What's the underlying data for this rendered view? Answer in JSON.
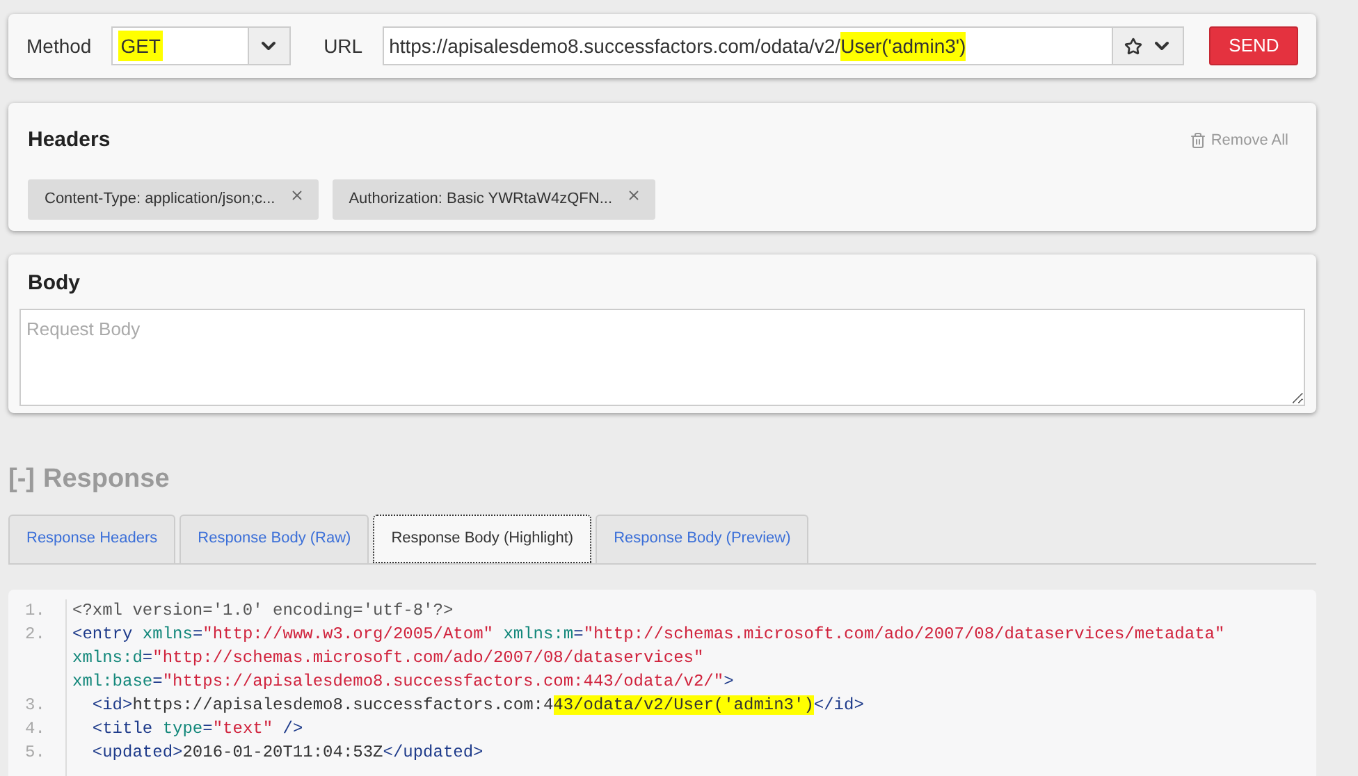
{
  "request": {
    "method_label": "Method",
    "method": {
      "value": "GET",
      "highlighted": true
    },
    "url_label": "URL",
    "url": [
      {
        "text": "https://apisalesdemo8.successfactors.com/odata/v2/",
        "highlighted": false
      },
      {
        "text": "User('admin3')",
        "highlighted": true
      }
    ],
    "send": "SEND"
  },
  "headers": {
    "title": "Headers",
    "remove_all": "Remove All",
    "items": [
      {
        "label": "Content-Type: application/json;c..."
      },
      {
        "label": "Authorization: Basic YWRtaW4zQFN..."
      }
    ]
  },
  "body": {
    "title": "Body",
    "placeholder": "Request Body"
  },
  "response": {
    "toggle": "[-]",
    "title": "Response",
    "tabs": [
      {
        "label": "Response Headers",
        "selected": false
      },
      {
        "label": "Response Body (Raw)",
        "selected": false
      },
      {
        "label": "Response Body (Highlight)",
        "selected": true
      },
      {
        "label": "Response Body (Preview)",
        "selected": false
      }
    ],
    "code": [
      {
        "number": "1.",
        "tokens": [
          {
            "kind": "decl",
            "text": "<?xml version='1.0' encoding='utf-8'?>"
          }
        ]
      },
      {
        "number": "2.",
        "tokens": [
          {
            "kind": "tag",
            "text": "<entry "
          },
          {
            "kind": "attr",
            "text": "xmlns"
          },
          {
            "kind": "tag",
            "text": "="
          },
          {
            "kind": "string",
            "text": "\"http://www.w3.org/2005/Atom\" "
          },
          {
            "kind": "attr",
            "text": "xmlns:m"
          },
          {
            "kind": "tag",
            "text": "="
          },
          {
            "kind": "string",
            "text": "\"http://schemas.microsoft.com/ado/2007/08/dataservices/metadata\" "
          },
          {
            "kind": "attr",
            "text": "xmlns:d"
          },
          {
            "kind": "tag",
            "text": "="
          },
          {
            "kind": "string",
            "text": "\"http://schemas.microsoft.com/ado/2007/08/dataservices\" "
          },
          {
            "kind": "attr",
            "text": "xml:base"
          },
          {
            "kind": "tag",
            "text": "="
          },
          {
            "kind": "string",
            "text": "\"https://apisalesdemo8.successfactors.com:443/odata/v2/\""
          },
          {
            "kind": "tag",
            "text": ">"
          }
        ]
      },
      {
        "number": "3.",
        "tokens": [
          {
            "kind": "tag",
            "text": "  <id>"
          },
          {
            "kind": "text",
            "text": "https://apisalesdemo8.successfactors.com:4"
          },
          {
            "kind": "text",
            "text": "43/odata/v2/User('admin3')",
            "highlighted": true
          },
          {
            "kind": "tag",
            "text": "</id>"
          }
        ]
      },
      {
        "number": "4.",
        "tokens": [
          {
            "kind": "tag",
            "text": "  <title "
          },
          {
            "kind": "attr",
            "text": "type"
          },
          {
            "kind": "tag",
            "text": "="
          },
          {
            "kind": "string",
            "text": "\"text\""
          },
          {
            "kind": "tag",
            "text": " />"
          }
        ]
      },
      {
        "number": "5.",
        "tokens": [
          {
            "kind": "tag",
            "text": "  <updated>"
          },
          {
            "kind": "text",
            "text": "2016-01-20T11:04:53Z"
          },
          {
            "kind": "tag",
            "text": "</updated>"
          }
        ]
      }
    ]
  }
}
